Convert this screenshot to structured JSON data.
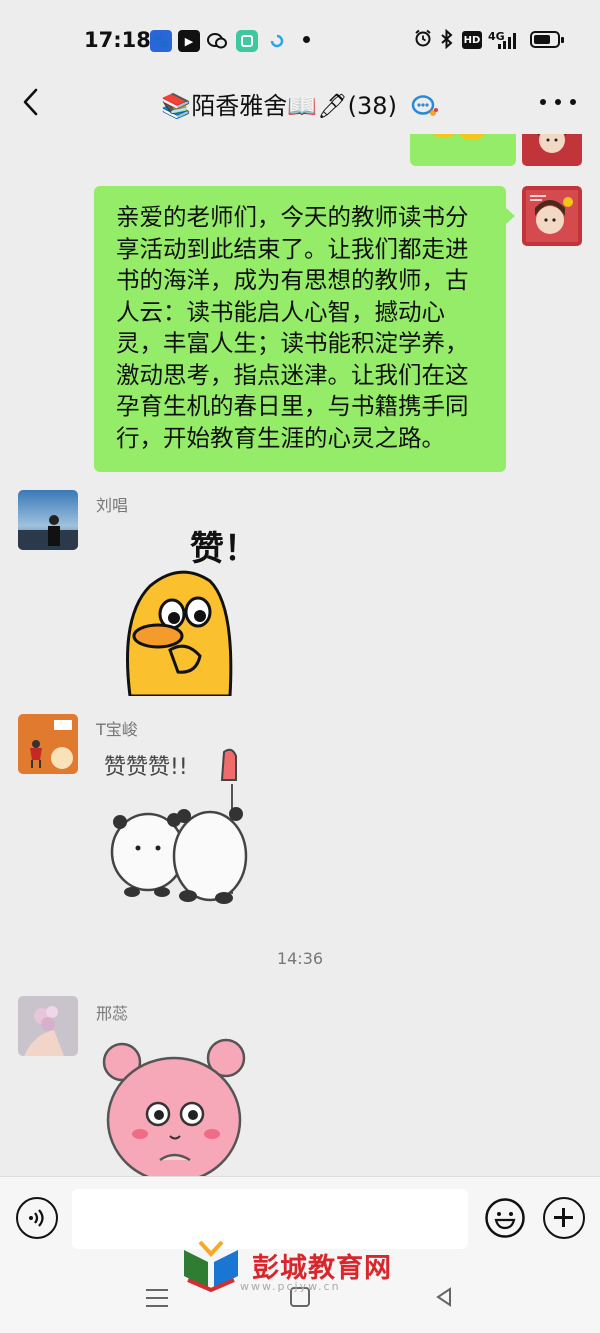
{
  "status_bar": {
    "time": "17:18",
    "network": "4G",
    "hd_label": "HD",
    "icons": [
      "baidu-paw-icon",
      "play-icon",
      "chat-bubble-icon",
      "app-icon",
      "spinner-icon",
      "alarm-icon",
      "bluetooth-icon",
      "battery-icon"
    ]
  },
  "header": {
    "title_prefix_icon": "books-emoji-icon",
    "title": "陌香雅舍",
    "title_icons": [
      "open-book-emoji-icon",
      "pen-emoji-icon"
    ],
    "member_count": "(38)",
    "group_badge_icon": "group-chat-badge-icon"
  },
  "messages": [
    {
      "type": "sticker",
      "sender": "self",
      "sticker": "yellow-sticker"
    },
    {
      "type": "text",
      "sender": "self",
      "text": "亲爱的老师们，今天的教师读书分享活动到此结束了。让我们都走进书的海洋，成为有思想的教师，古人云：读书能启人心智，撼动心灵，丰富人生；读书能积淀学养，激动思考，指点迷津。让我们在这孕育生机的春日里，与书籍携手同行，开始教育生涯的心灵之路。"
    },
    {
      "type": "sticker",
      "sender_name": "刘唱",
      "sticker": "yellow-duck-sticker",
      "sticker_text": "赞！"
    },
    {
      "type": "sticker",
      "sender_name": "T宝峻",
      "sticker": "white-bears-sticker",
      "sticker_text": "赞赞赞!!"
    },
    {
      "type": "timestamp",
      "text": "14:36"
    },
    {
      "type": "sticker",
      "sender_name": "邢蕊",
      "sticker": "pink-bear-sticker"
    }
  ],
  "input_bar": {
    "placeholder": "",
    "voice_icon": "voice-icon",
    "emoji_icon": "emoji-icon",
    "plus_icon": "plus-icon"
  },
  "nav": {
    "icons": [
      "menu-icon",
      "home-icon",
      "back-triangle-icon"
    ]
  },
  "watermark": {
    "text": "彭城教育网",
    "sub": "www.pcjyw.cn"
  },
  "colors": {
    "bubble_self": "#95ec69",
    "background": "#ededed",
    "watermark_red": "#d9262c"
  }
}
